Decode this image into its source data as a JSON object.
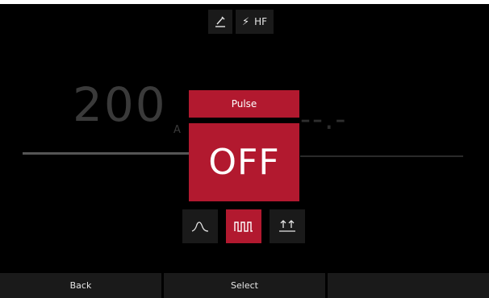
{
  "status": {
    "weld_icon": "torch-electrode-icon",
    "hf_icon": "lightning-icon",
    "hf_label": "HF"
  },
  "display": {
    "current_value": "200",
    "current_unit": "A",
    "secondary_value": "--.-"
  },
  "pulse": {
    "title": "Pulse",
    "value": "OFF"
  },
  "modes": [
    {
      "name": "pulse-slope-mode",
      "icon": "slope-curve-icon",
      "active": false
    },
    {
      "name": "pulse-square-mode",
      "icon": "square-wave-icon",
      "active": true
    },
    {
      "name": "pulse-2t-4t-mode",
      "icon": "up-arrows-icon",
      "active": false
    }
  ],
  "softkeys": {
    "left": "Back",
    "middle": "Select",
    "right": ""
  },
  "colors": {
    "accent": "#b2192f",
    "panel": "#1a1a1a",
    "background": "#000000"
  }
}
